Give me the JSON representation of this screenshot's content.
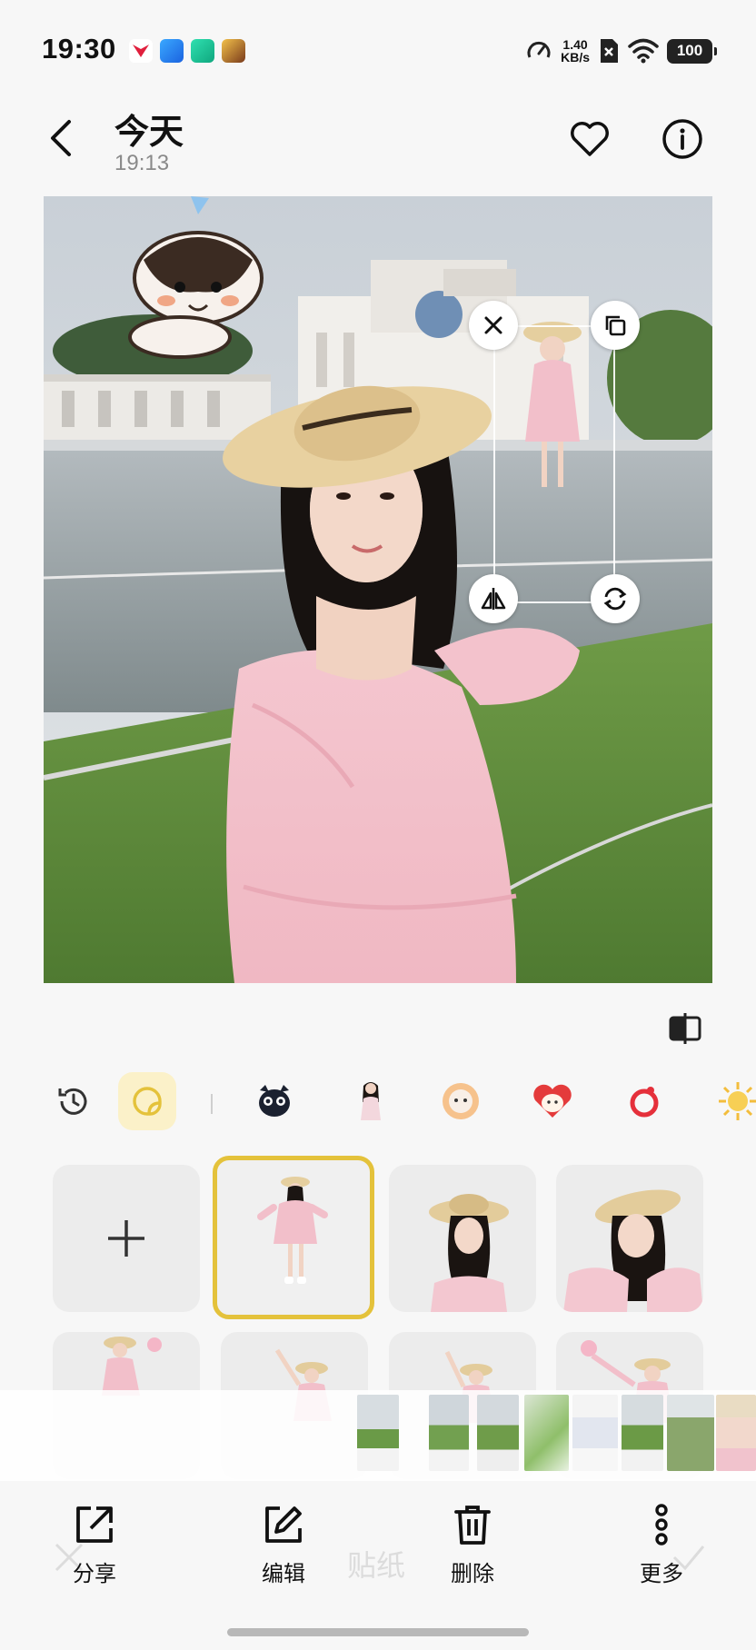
{
  "status_bar": {
    "time": "19:30",
    "network_speed_value": "1.40",
    "network_speed_unit": "KB/s",
    "battery": "100"
  },
  "header": {
    "title": "今天",
    "subtitle": "19:13"
  },
  "sticker_panel": {
    "ghost_title": "贴纸",
    "categories": [
      "history-icon",
      "sticker-icon",
      "dog-sticker",
      "girl-sticker",
      "flower-sticker",
      "heart-sticker",
      "ring-sticker",
      "sun-sticker"
    ],
    "selected_tile": 1
  },
  "toolbar": {
    "share_label": "分享",
    "edit_label": "编辑",
    "delete_label": "删除",
    "more_label": "更多"
  },
  "colors": {
    "accent": "#e4c23b",
    "background": "#f7f7f7"
  }
}
